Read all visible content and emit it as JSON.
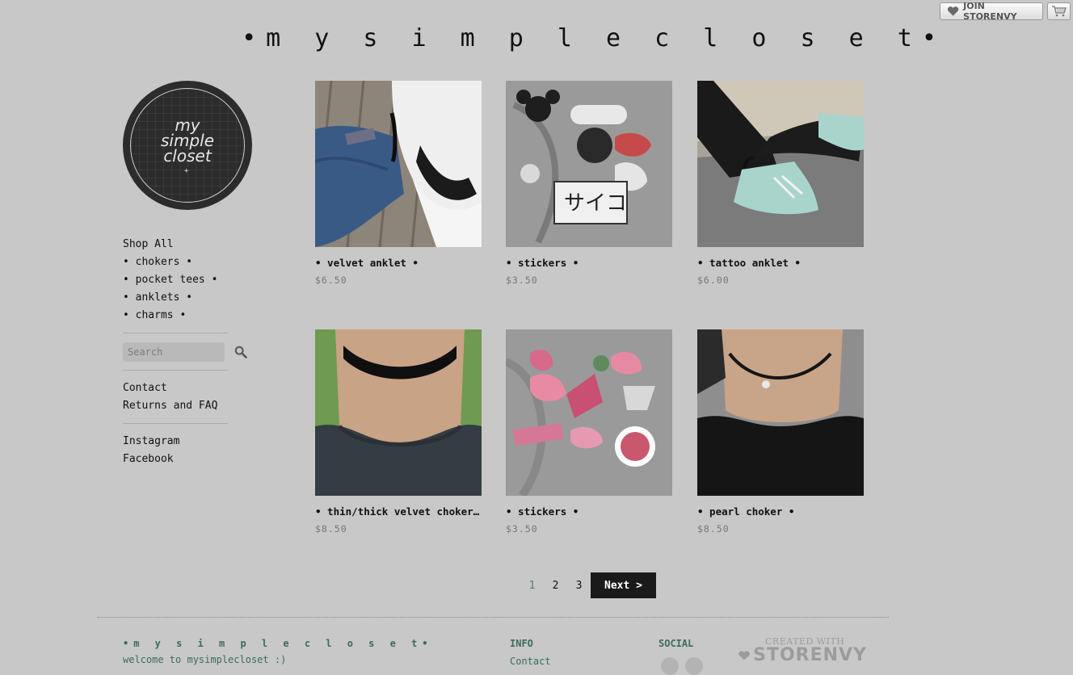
{
  "topbar": {
    "join_label": "JOIN STORENVY",
    "join_icon": "heart-icon",
    "cart_icon": "cart-icon"
  },
  "site": {
    "title": "•m y s i m p l e c l o s e t•"
  },
  "logo": {
    "text": "my\nsimple\ncloset",
    "star": "+"
  },
  "sidebar": {
    "categories": [
      {
        "label": "Shop All"
      },
      {
        "label": "• chokers •"
      },
      {
        "label": "• pocket tees •"
      },
      {
        "label": "• anklets •"
      },
      {
        "label": "• charms •"
      }
    ],
    "search": {
      "placeholder": "Search",
      "icon": "search-icon"
    },
    "pages": [
      {
        "label": "Contact"
      },
      {
        "label": "Returns and FAQ"
      }
    ],
    "social": [
      {
        "label": "Instagram"
      },
      {
        "label": "Facebook"
      }
    ]
  },
  "products": [
    {
      "name": "• velvet anklet •",
      "price": "$6.50"
    },
    {
      "name": "• stickers •",
      "price": "$3.50"
    },
    {
      "name": "• tattoo anklet •",
      "price": "$6.00"
    },
    {
      "name": "• thin/thick velvet choker •",
      "price": "$8.50"
    },
    {
      "name": "• stickers •",
      "price": "$3.50"
    },
    {
      "name": "• pearl choker •",
      "price": "$8.50"
    }
  ],
  "pagination": {
    "pages": [
      "1",
      "2",
      "3"
    ],
    "current": "1",
    "next_label": "Next >"
  },
  "footer": {
    "brand": "•m y s i m p l e c l o s e t•",
    "welcome": "welcome to mysimplecloset :)",
    "info_heading": "INFO",
    "info_contact": "Contact",
    "social_heading": "SOCIAL",
    "created_small": "CREATED WITH",
    "created_big": "STORENVY"
  },
  "colors": {
    "background": "#c8c8c8",
    "footer_text": "#3d6b5e",
    "next_button": "#1a1a1a",
    "current_page": "#4f7f6f"
  }
}
